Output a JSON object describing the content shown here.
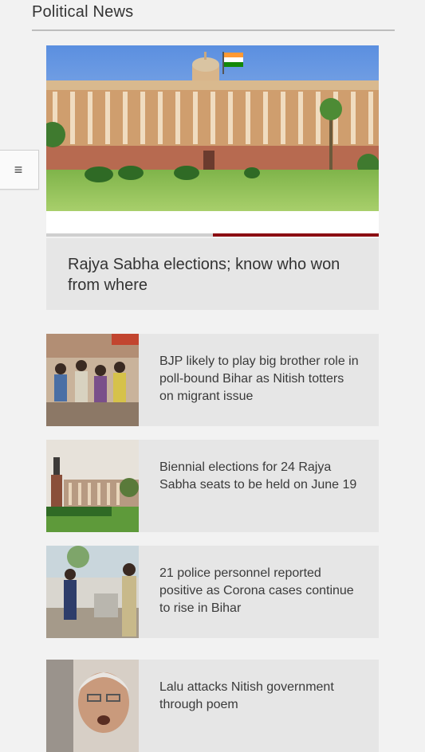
{
  "header": {
    "title": "Political News"
  },
  "menu": {
    "icon": "hamburger-menu-icon",
    "glyph": "≡"
  },
  "featured": {
    "headline": "Rajya Sabha elections; know who won from where",
    "image": "parliament-building-image",
    "carousel_progress_percent": 50,
    "accent_color": "#8b0e12"
  },
  "articles": [
    {
      "headline": "BJP likely to play big brother role in poll-bound Bihar as Nitish totters on migrant issue",
      "image": "migrant-crowd-image"
    },
    {
      "headline": "Biennial elections for 24 Rajya Sabha seats to be held on June 19",
      "image": "parliament-statue-image"
    },
    {
      "headline": "21 police personnel reported positive as Corona cases continue to rise in Bihar",
      "image": "police-officer-image"
    },
    {
      "headline": "Lalu attacks Nitish government through poem",
      "image": "lalu-portrait-image"
    }
  ]
}
